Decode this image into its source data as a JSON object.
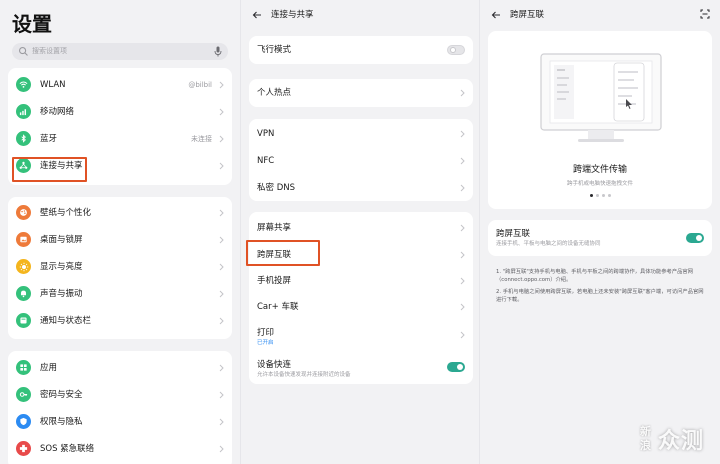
{
  "settings": {
    "title": "设置",
    "search_placeholder": "搜索设置项",
    "groups": [
      {
        "items": [
          {
            "label": "WLAN",
            "value": "@bilbil",
            "icon": "wifi-icon",
            "color": "#34c17b"
          },
          {
            "label": "移动网络",
            "value": "",
            "icon": "cellular-icon",
            "color": "#34c17b"
          },
          {
            "label": "蓝牙",
            "value": "未连接",
            "icon": "bluetooth-icon",
            "color": "#34c17b"
          },
          {
            "label": "连接与共享",
            "value": "",
            "icon": "share-icon",
            "color": "#34c17b"
          }
        ]
      },
      {
        "items": [
          {
            "label": "壁纸与个性化",
            "icon": "palette-icon",
            "color": "#ee7a3a"
          },
          {
            "label": "桌面与锁屏",
            "icon": "image-icon",
            "color": "#ee7a3a"
          },
          {
            "label": "显示与亮度",
            "icon": "sun-icon",
            "color": "#f4b51d"
          },
          {
            "label": "声音与振动",
            "icon": "bell-icon",
            "color": "#34c17b"
          },
          {
            "label": "通知与状态栏",
            "icon": "notification-icon",
            "color": "#34c17b"
          }
        ]
      },
      {
        "items": [
          {
            "label": "应用",
            "icon": "apps-icon",
            "color": "#34c17b"
          },
          {
            "label": "密码与安全",
            "icon": "key-icon",
            "color": "#34c17b"
          },
          {
            "label": "权限与隐私",
            "icon": "shield-icon",
            "color": "#2c8bf2"
          },
          {
            "label": "SOS 紧急联络",
            "icon": "sos-icon",
            "color": "#e84a4a"
          }
        ]
      }
    ]
  },
  "connection": {
    "title": "连接与共享",
    "airplane_label": "飞行模式",
    "airplane_on": false,
    "hotspot_label": "个人热点",
    "net_items": [
      "VPN",
      "NFC",
      "私密 DNS"
    ],
    "share_items": [
      {
        "label": "屏幕共享",
        "sub": ""
      },
      {
        "label": "跨屏互联",
        "sub": ""
      },
      {
        "label": "手机投屏",
        "sub": ""
      },
      {
        "label": "Car+ 车联",
        "sub": ""
      },
      {
        "label": "打印",
        "sub": "已开启"
      }
    ],
    "quick_label": "设备快连",
    "quick_sub": "允许本设备快速发现并连接附近的设备",
    "quick_on": true
  },
  "cross_screen": {
    "title": "跨屏互联",
    "hero_title": "跨端文件传输",
    "hero_sub": "跨手机或电脑快速拖拽文件",
    "dots_total": 4,
    "dots_active": 0,
    "toggle_label": "跨屏互联",
    "toggle_sub": "连接手机、平板与电脑之间的设备无缝协同",
    "toggle_on": true,
    "notes": [
      "1. \"跨屏互联\"支持手机与电脑、手机与平板之间的跨端协作，具体功能参考产品官网（connect.oppo.com）介绍。",
      "2. 手机与电脑之间使用跨屏互联，若电脑上还未安装\"跨屏互联\"客户端，可访问产品官网进行下载。"
    ]
  },
  "watermark": {
    "chars": [
      "新",
      "浪"
    ],
    "big": "众测"
  },
  "colors": {
    "accent_green": "#2ba891",
    "highlight": "#e05225",
    "link_blue": "#2c8bf2"
  }
}
